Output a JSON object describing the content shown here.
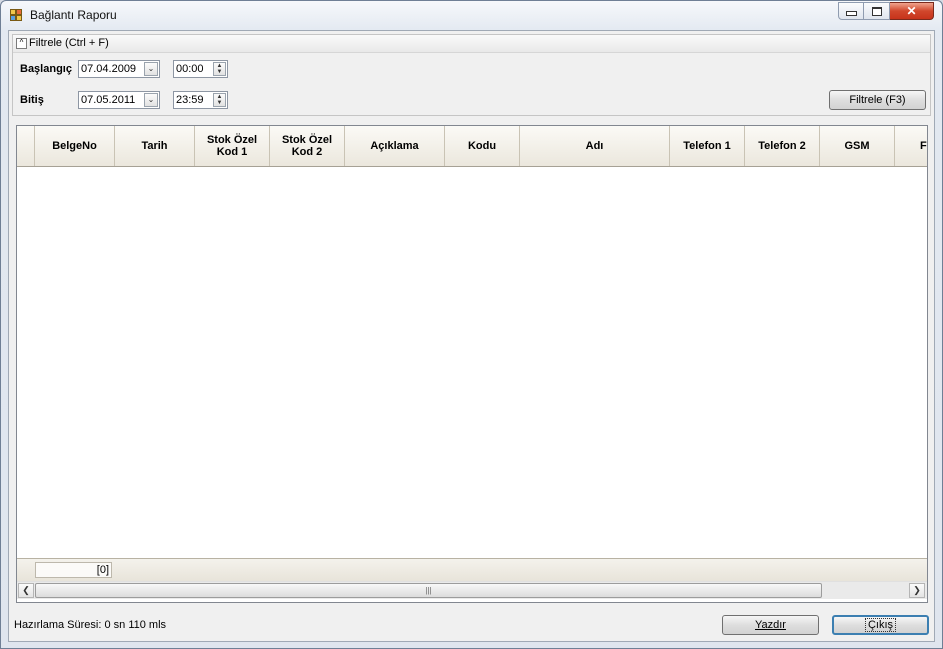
{
  "window": {
    "title": "Bağlantı Raporu",
    "controls": {
      "minimize": "—",
      "maximize": "□",
      "close": "✕"
    }
  },
  "filter": {
    "title": "Filtrele (Ctrl + F)",
    "start_label": "Başlangıç",
    "start_date": "07.04.2009",
    "start_time": "00:00",
    "end_label": "Bitiş",
    "end_date": "07.05.2011",
    "end_time": "23:59",
    "filter_button": "Filtrele (F3)"
  },
  "grid": {
    "columns": [
      "BelgeNo",
      "Tarih",
      "Stok Özel\nKod 1",
      "Stok Özel\nKod 2",
      "Açıklama",
      "Kodu",
      "Adı",
      "Telefon 1",
      "Telefon 2",
      "GSM",
      "Fa"
    ],
    "row_count": "[0]"
  },
  "footer": {
    "status": "Hazırlama Süresi: 0 sn 110 mls",
    "print_button": "Yazdır",
    "exit_button": "Çıkış"
  }
}
